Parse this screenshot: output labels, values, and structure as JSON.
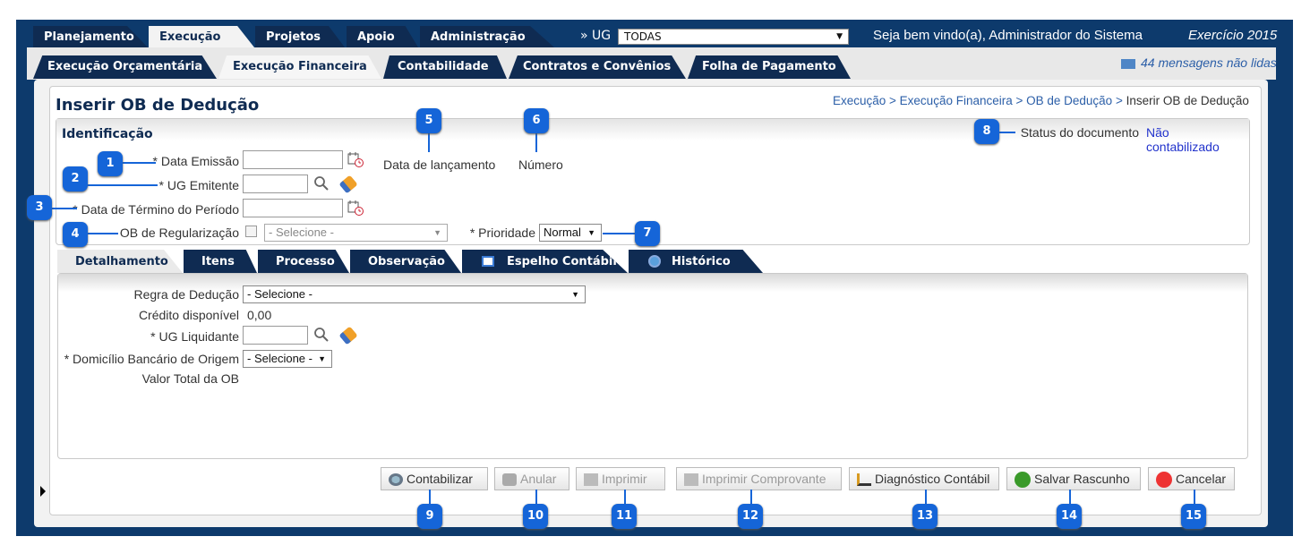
{
  "top_tabs": [
    {
      "label": "Planejamento",
      "active": false
    },
    {
      "label": "Execução",
      "active": true
    },
    {
      "label": "Projetos",
      "active": false
    },
    {
      "label": "Apoio",
      "active": false
    },
    {
      "label": "Administração",
      "active": false
    }
  ],
  "ug": {
    "label": "» UG",
    "selected": "TODAS"
  },
  "welcome": "Seja bem vindo(a), Administrador do Sistema",
  "exercicio": "Exercício 2015",
  "sub_tabs": [
    {
      "label": "Execução Orçamentária",
      "active": false
    },
    {
      "label": "Execução Financeira",
      "active": true
    },
    {
      "label": "Contabilidade",
      "active": false
    },
    {
      "label": "Contratos e Convênios",
      "active": false
    },
    {
      "label": "Folha de Pagamento",
      "active": false
    }
  ],
  "messages": "44 mensagens não lidas",
  "page_title": "Inserir OB de Dedução",
  "breadcrumb": {
    "trail": "Execução > Execução Financeira > OB de Dedução > ",
    "current": "Inserir OB de Dedução"
  },
  "identificacao": {
    "title": "Identificação",
    "data_emissao_label": "* Data Emissão",
    "ug_emitente_label": "* UG Emitente",
    "data_termino_label": "* Data de Término do Período",
    "ob_regularizacao_label": "OB de Regularização",
    "ob_regularizacao_select": "- Selecione -",
    "data_lancamento_label": "Data de lançamento",
    "numero_label": "Número",
    "prioridade_label": "* Prioridade",
    "prioridade_value": "Normal",
    "status_label": "Status do documento",
    "status_value": "Não contabilizado"
  },
  "detail_tabs": [
    {
      "label": "Detalhamento",
      "active": true
    },
    {
      "label": "Itens",
      "active": false
    },
    {
      "label": "Processo",
      "active": false
    },
    {
      "label": "Observação",
      "active": false
    },
    {
      "label": "Espelho Contábil",
      "active": false
    },
    {
      "label": "Histórico",
      "active": false
    }
  ],
  "detalhamento": {
    "regra_label": "Regra de Dedução",
    "regra_value": "- Selecione -",
    "credito_label": "Crédito disponível",
    "credito_value": "0,00",
    "ug_liquidante_label": "* UG Liquidante",
    "domicilio_label": "* Domicílio Bancário de Origem",
    "domicilio_value": "- Selecione -",
    "valor_total_label": "Valor Total da OB"
  },
  "buttons": [
    {
      "label": "Contabilizar",
      "enabled": true
    },
    {
      "label": "Anular",
      "enabled": false
    },
    {
      "label": "Imprimir",
      "enabled": false
    },
    {
      "label": "Imprimir Comprovante",
      "enabled": false
    },
    {
      "label": "Diagnóstico Contábil",
      "enabled": true
    },
    {
      "label": "Salvar Rascunho",
      "enabled": true
    },
    {
      "label": "Cancelar",
      "enabled": true
    }
  ],
  "callouts": [
    "1",
    "2",
    "3",
    "4",
    "5",
    "6",
    "7",
    "8",
    "9",
    "10",
    "11",
    "12",
    "13",
    "14",
    "15"
  ],
  "colors": {
    "nav": "#0f2b52",
    "frame": "#0d3a6c",
    "callout": "#1565d8",
    "link": "#2c5fa8"
  }
}
